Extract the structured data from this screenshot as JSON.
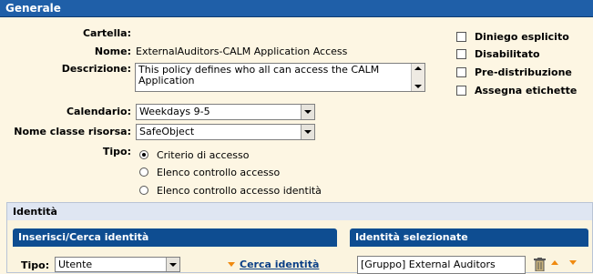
{
  "general": {
    "header": "Generale",
    "folder_label": "Cartella:",
    "folder_value": "",
    "name_label": "Nome:",
    "name_value": "ExternalAuditors-CALM Application Access",
    "description_label": "Descrizione:",
    "description_value": "This policy defines who all can access the CALM Application",
    "calendar_label": "Calendario:",
    "calendar_value": "Weekdays 9-5",
    "resource_class_label": "Nome classe risorsa:",
    "resource_class_value": "SafeObject",
    "type_label": "Tipo:",
    "type_options": [
      {
        "label": "Criterio di accesso",
        "checked": true
      },
      {
        "label": "Elenco controllo accesso",
        "checked": false
      },
      {
        "label": "Elenco controllo accesso identità",
        "checked": false
      }
    ],
    "checkboxes": [
      {
        "label": "Diniego esplicito",
        "checked": false
      },
      {
        "label": "Disabilitato",
        "checked": false
      },
      {
        "label": "Pre-distribuzione",
        "checked": false
      },
      {
        "label": "Assegna etichette",
        "checked": false
      }
    ]
  },
  "identity": {
    "title": "Identità",
    "search_panel": {
      "header": "Inserisci/Cerca identità",
      "type_label": "Tipo:",
      "type_value": "Utente",
      "search_link": "Cerca identità"
    },
    "selected_panel": {
      "header": "Identità selezionate",
      "items": [
        "[Gruppo] External Auditors"
      ]
    }
  },
  "colors": {
    "header_blue": "#1f5fa8",
    "subpanel_blue": "#0e4d91",
    "background": "#fdf6e3",
    "accent_orange": "#f08a10"
  },
  "icons": {
    "delete": "trash-icon",
    "move_up": "arrow-up-icon",
    "move_down": "arrow-down-icon",
    "search_link": "triangle-down-icon"
  }
}
